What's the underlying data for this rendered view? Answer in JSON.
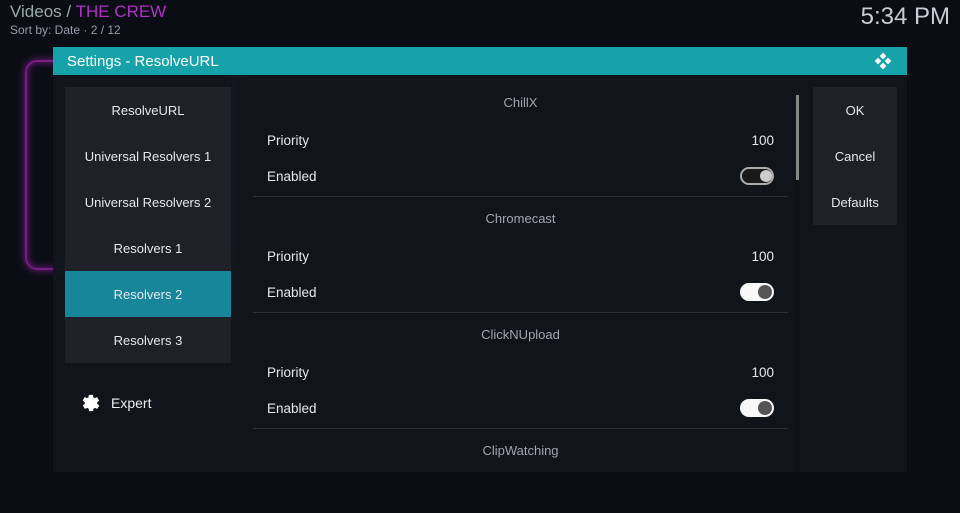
{
  "header": {
    "breadcrumb_prefix": "Videos",
    "breadcrumb_sep": " / ",
    "breadcrumb_page": "THE CREW",
    "sort_line": "Sort by: Date  · 2 / 12",
    "clock": "5:34 PM"
  },
  "dialog": {
    "title": "Settings - ResolveURL"
  },
  "sidebar": {
    "items": [
      {
        "label": "ResolveURL"
      },
      {
        "label": "Universal Resolvers 1"
      },
      {
        "label": "Universal Resolvers 2"
      },
      {
        "label": "Resolvers 1"
      },
      {
        "label": "Resolvers 2"
      },
      {
        "label": "Resolvers 3"
      }
    ],
    "level": "Expert"
  },
  "buttons": {
    "ok": "OK",
    "cancel": "Cancel",
    "defaults": "Defaults"
  },
  "settings": {
    "groups": [
      {
        "name": "ChillX",
        "rows": [
          {
            "label": "Priority",
            "value": "100",
            "type": "number"
          },
          {
            "label": "Enabled",
            "type": "toggle",
            "on": true,
            "highlight": true
          }
        ]
      },
      {
        "name": "Chromecast",
        "rows": [
          {
            "label": "Priority",
            "value": "100",
            "type": "number"
          },
          {
            "label": "Enabled",
            "type": "toggle",
            "on": true
          }
        ]
      },
      {
        "name": "ClickNUpload",
        "rows": [
          {
            "label": "Priority",
            "value": "100",
            "type": "number"
          },
          {
            "label": "Enabled",
            "type": "toggle",
            "on": true
          }
        ]
      },
      {
        "name": "ClipWatching",
        "rows": []
      }
    ]
  }
}
